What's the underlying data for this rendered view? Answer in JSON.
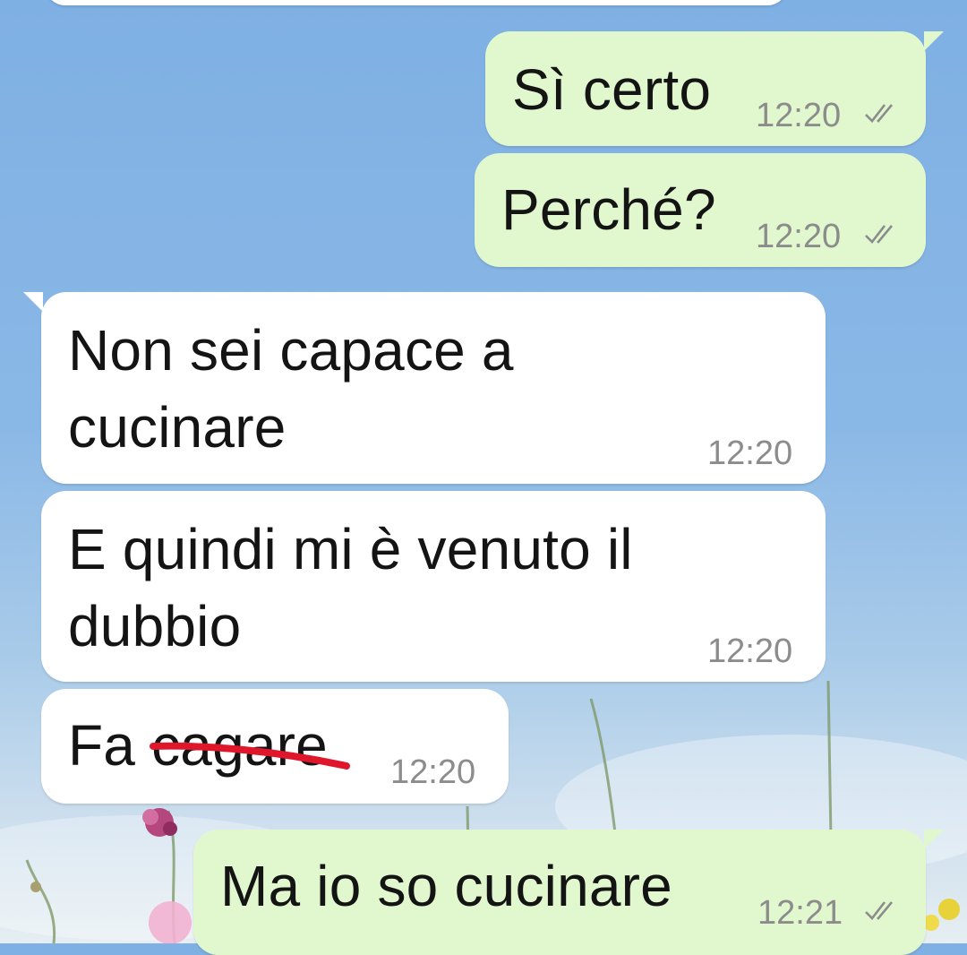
{
  "messages": [
    {
      "direction": "outgoing",
      "text": "Sì certo",
      "time": "12:20",
      "status_icon": "double-check-icon"
    },
    {
      "direction": "outgoing",
      "text": "Perché?",
      "time": "12:20",
      "status_icon": "double-check-icon"
    },
    {
      "direction": "incoming",
      "line1": "Non sei capace a",
      "line2": "cucinare",
      "time": "12:20"
    },
    {
      "direction": "incoming",
      "line1": "E quindi mi è venuto il",
      "line2": "dubbio",
      "time": "12:20"
    },
    {
      "direction": "incoming",
      "text_prefix": "Fa ",
      "struck_word": "cagare",
      "time": "12:20"
    },
    {
      "direction": "outgoing",
      "text": "Ma io so cucinare",
      "time": "12:21",
      "status_icon": "double-check-icon"
    }
  ],
  "colors": {
    "outgoing_bubble": "#e1f8cf",
    "incoming_bubble": "#ffffff",
    "strike_mark": "#e0162b",
    "timestamp": "#8c8c8c"
  }
}
